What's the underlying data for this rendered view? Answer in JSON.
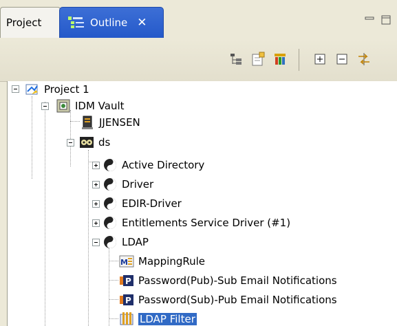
{
  "tabs": [
    {
      "label": "Project"
    },
    {
      "label": "Outline",
      "close": "✕"
    }
  ],
  "tree": {
    "nodes": [
      {
        "label": "Project 1",
        "icon": "project-icon",
        "expanded": true
      },
      {
        "label": "IDM Vault",
        "icon": "vault-icon",
        "expanded": true
      },
      {
        "label": "JJENSEN",
        "icon": "server-icon"
      },
      {
        "label": "ds",
        "icon": "driver-set-icon",
        "expanded": true
      },
      {
        "label": "Active Directory",
        "icon": "driver-icon",
        "expanded": false
      },
      {
        "label": "Driver",
        "icon": "driver-icon",
        "expanded": false
      },
      {
        "label": "EDIR-Driver",
        "icon": "driver-icon",
        "expanded": false
      },
      {
        "label": "Entitlements Service Driver (#1)",
        "icon": "driver-icon",
        "expanded": false
      },
      {
        "label": "LDAP",
        "icon": "driver-icon",
        "expanded": true
      },
      {
        "label": "MappingRule",
        "icon": "mapping-rule-icon"
      },
      {
        "label": "Password(Pub)-Sub Email Notifications",
        "icon": "policy-icon"
      },
      {
        "label": "Password(Sub)-Pub Email Notifications",
        "icon": "policy-icon"
      },
      {
        "label": "LDAP Filter",
        "icon": "filter-icon",
        "selected": true
      }
    ]
  },
  "colors": {
    "active_tab": "#2459c9",
    "selection": "#316ac5",
    "background": "#ece9d8"
  }
}
